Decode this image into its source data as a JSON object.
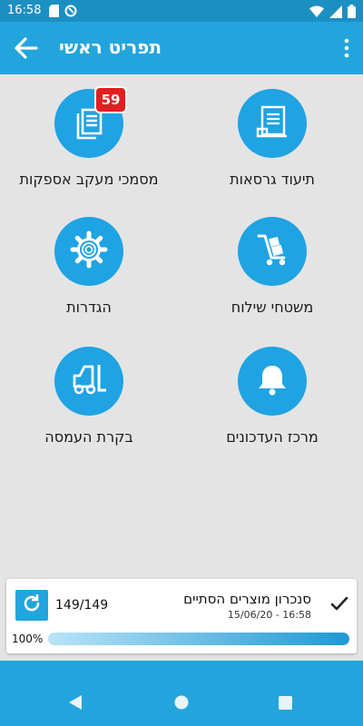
{
  "status_bar": {
    "time": "16:58",
    "left_icons": [
      "sd-card-icon",
      "sync-circle-icon"
    ],
    "right_icons": [
      "wifi-icon",
      "signal-icon",
      "battery-icon"
    ]
  },
  "app_bar": {
    "title": "תפריט ראשי",
    "back_icon": "arrow-back-icon",
    "menu_icon": "more-vert-icon"
  },
  "tiles": [
    {
      "label": "תיעוד גרסאות",
      "icon": "document-list-icon"
    },
    {
      "label": "מסמכי מעקב אספקות",
      "icon": "documents-icon",
      "badge": "59"
    },
    {
      "label": "משטחי שילוח",
      "icon": "hand-truck-icon"
    },
    {
      "label": "הגדרות",
      "icon": "gear-icon"
    },
    {
      "label": "מרכז העדכונים",
      "icon": "bell-icon"
    },
    {
      "label": "בקרת העמסה",
      "icon": "forklift-icon"
    }
  ],
  "sync": {
    "title": "סנכרון מוצרים הסתיים",
    "date": "15/06/20 - 16:58",
    "count": "149/149",
    "percent_label": "100%",
    "progress": 1.0
  },
  "colors": {
    "primary": "#22a5dd",
    "status_bar": "#1c8fc2",
    "icon_circle": "#1fa3e3",
    "badge": "#e02020",
    "background": "#e4e4e4"
  }
}
